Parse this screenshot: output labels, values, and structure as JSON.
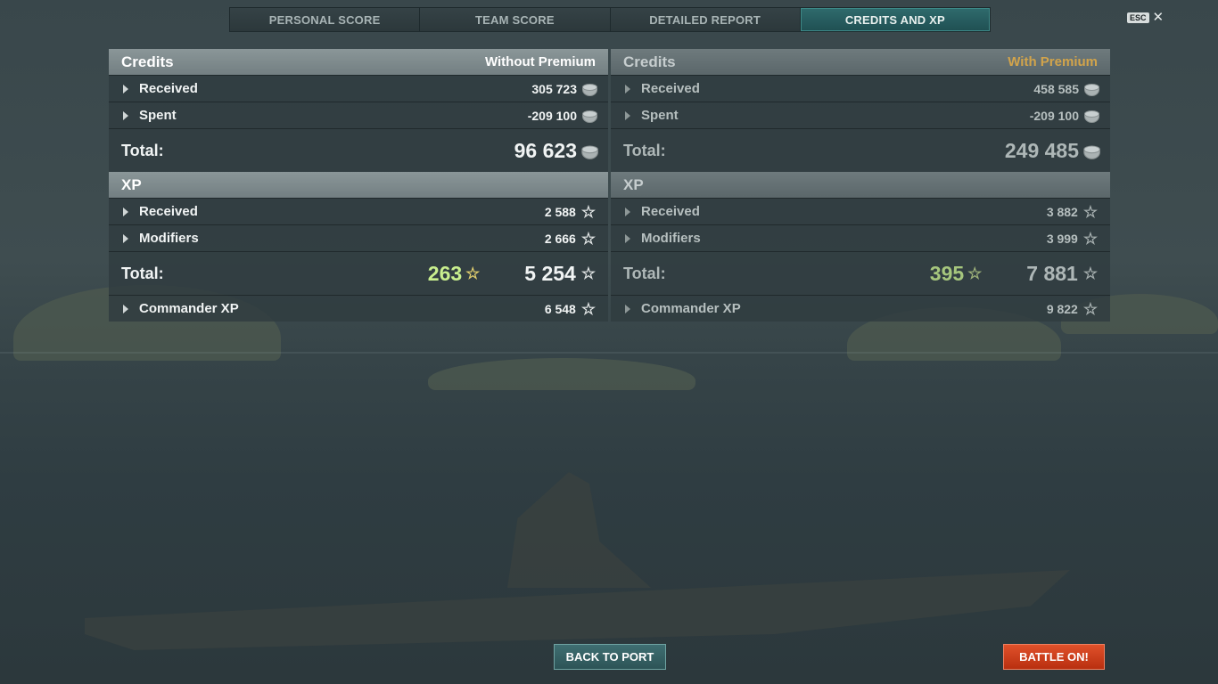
{
  "tabs": [
    {
      "label": "PERSONAL SCORE"
    },
    {
      "label": "TEAM SCORE"
    },
    {
      "label": "DETAILED REPORT"
    },
    {
      "label": "CREDITS AND XP"
    }
  ],
  "esc": {
    "key": "ESC",
    "close": "✕"
  },
  "without_premium": {
    "credits_header": "Credits",
    "credits_sub": "Without Premium",
    "received_label": "Received",
    "received_value": "305 723",
    "spent_label": "Spent",
    "spent_value": "-209 100",
    "credits_total_label": "Total:",
    "credits_total_value": "96 623",
    "xp_header": "XP",
    "xp_received_label": "Received",
    "xp_received_value": "2 588",
    "modifiers_label": "Modifiers",
    "modifiers_value": "2 666",
    "xp_total_label": "Total:",
    "xp_free_value": "263",
    "xp_total_value": "5 254",
    "commander_label": "Commander XP",
    "commander_value": "6 548"
  },
  "with_premium": {
    "credits_header": "Credits",
    "credits_sub": "With Premium",
    "received_label": "Received",
    "received_value": "458 585",
    "spent_label": "Spent",
    "spent_value": "-209 100",
    "credits_total_label": "Total:",
    "credits_total_value": "249 485",
    "xp_header": "XP",
    "xp_received_label": "Received",
    "xp_received_value": "3 882",
    "modifiers_label": "Modifiers",
    "modifiers_value": "3 999",
    "xp_total_label": "Total:",
    "xp_free_value": "395",
    "xp_total_value": "7 881",
    "commander_label": "Commander XP",
    "commander_value": "9 822"
  },
  "buttons": {
    "back_to_port": "BACK TO PORT",
    "battle_on": "BATTLE ON!"
  },
  "icons": {
    "credits": "credits-coin-icon",
    "xp": "star-icon",
    "free_xp": "gold-star-icon",
    "expand": "expand-arrow-icon"
  },
  "colors": {
    "active_tab": "#2f6b6d",
    "premium_text": "#d2a44b",
    "free_xp_text": "#c9ef8e",
    "battle_button": "#d0401d",
    "port_button": "#3a6669"
  }
}
